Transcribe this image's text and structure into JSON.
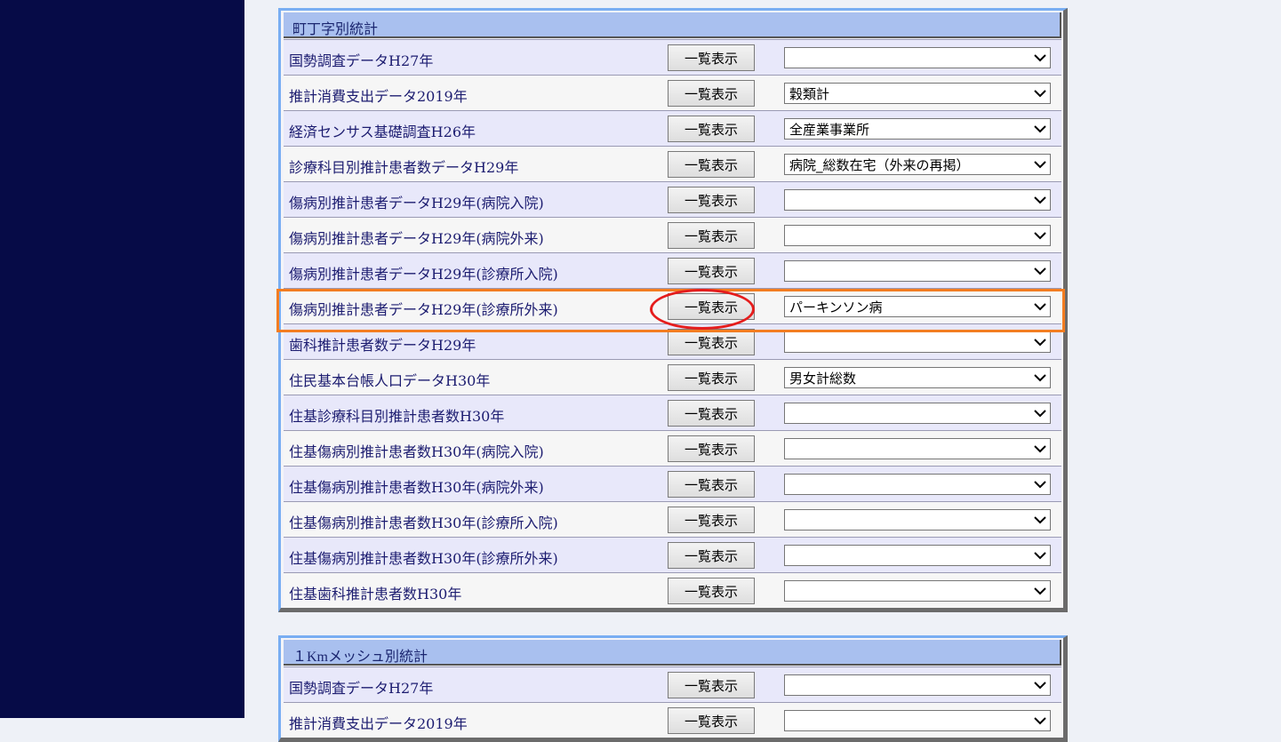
{
  "sections": [
    {
      "title": "町丁字別統計",
      "rows": [
        {
          "label": "国勢調査データH27年",
          "button": "一覧表示",
          "selected": ""
        },
        {
          "label": "推計消費支出データ2019年",
          "button": "一覧表示",
          "selected": "穀類計"
        },
        {
          "label": "経済センサス基礎調査H26年",
          "button": "一覧表示",
          "selected": "全産業事業所"
        },
        {
          "label": "診療科目別推計患者数データH29年",
          "button": "一覧表示",
          "selected": "病院_総数在宅（外来の再掲）"
        },
        {
          "label": "傷病別推計患者データH29年(病院入院)",
          "button": "一覧表示",
          "selected": ""
        },
        {
          "label": "傷病別推計患者データH29年(病院外来)",
          "button": "一覧表示",
          "selected": ""
        },
        {
          "label": "傷病別推計患者データH29年(診療所入院)",
          "button": "一覧表示",
          "selected": ""
        },
        {
          "label": "傷病別推計患者データH29年(診療所外来)",
          "button": "一覧表示",
          "selected": "パーキンソン病"
        },
        {
          "label": "歯科推計患者数データH29年",
          "button": "一覧表示",
          "selected": ""
        },
        {
          "label": "住民基本台帳人口データH30年",
          "button": "一覧表示",
          "selected": "男女計総数"
        },
        {
          "label": "住基診療科目別推計患者数H30年",
          "button": "一覧表示",
          "selected": ""
        },
        {
          "label": "住基傷病別推計患者数H30年(病院入院)",
          "button": "一覧表示",
          "selected": ""
        },
        {
          "label": "住基傷病別推計患者数H30年(病院外来)",
          "button": "一覧表示",
          "selected": ""
        },
        {
          "label": "住基傷病別推計患者数H30年(診療所入院)",
          "button": "一覧表示",
          "selected": ""
        },
        {
          "label": "住基傷病別推計患者数H30年(診療所外来)",
          "button": "一覧表示",
          "selected": ""
        },
        {
          "label": "住基歯科推計患者数H30年",
          "button": "一覧表示",
          "selected": ""
        }
      ]
    },
    {
      "title": "１Kmメッシュ別統計",
      "rows": [
        {
          "label": "国勢調査データH27年",
          "button": "一覧表示",
          "selected": ""
        },
        {
          "label": "推計消費支出データ2019年",
          "button": "一覧表示",
          "selected": ""
        }
      ]
    }
  ],
  "highlight": {
    "row_index": 7,
    "rect_color": "#f37d21",
    "ellipse_color": "#e51d1d"
  },
  "colors": {
    "sidebar": "#060b47",
    "header": "#a9c0ef",
    "row_odd": "#e8e8fa",
    "row_even": "#f6f6f6"
  }
}
